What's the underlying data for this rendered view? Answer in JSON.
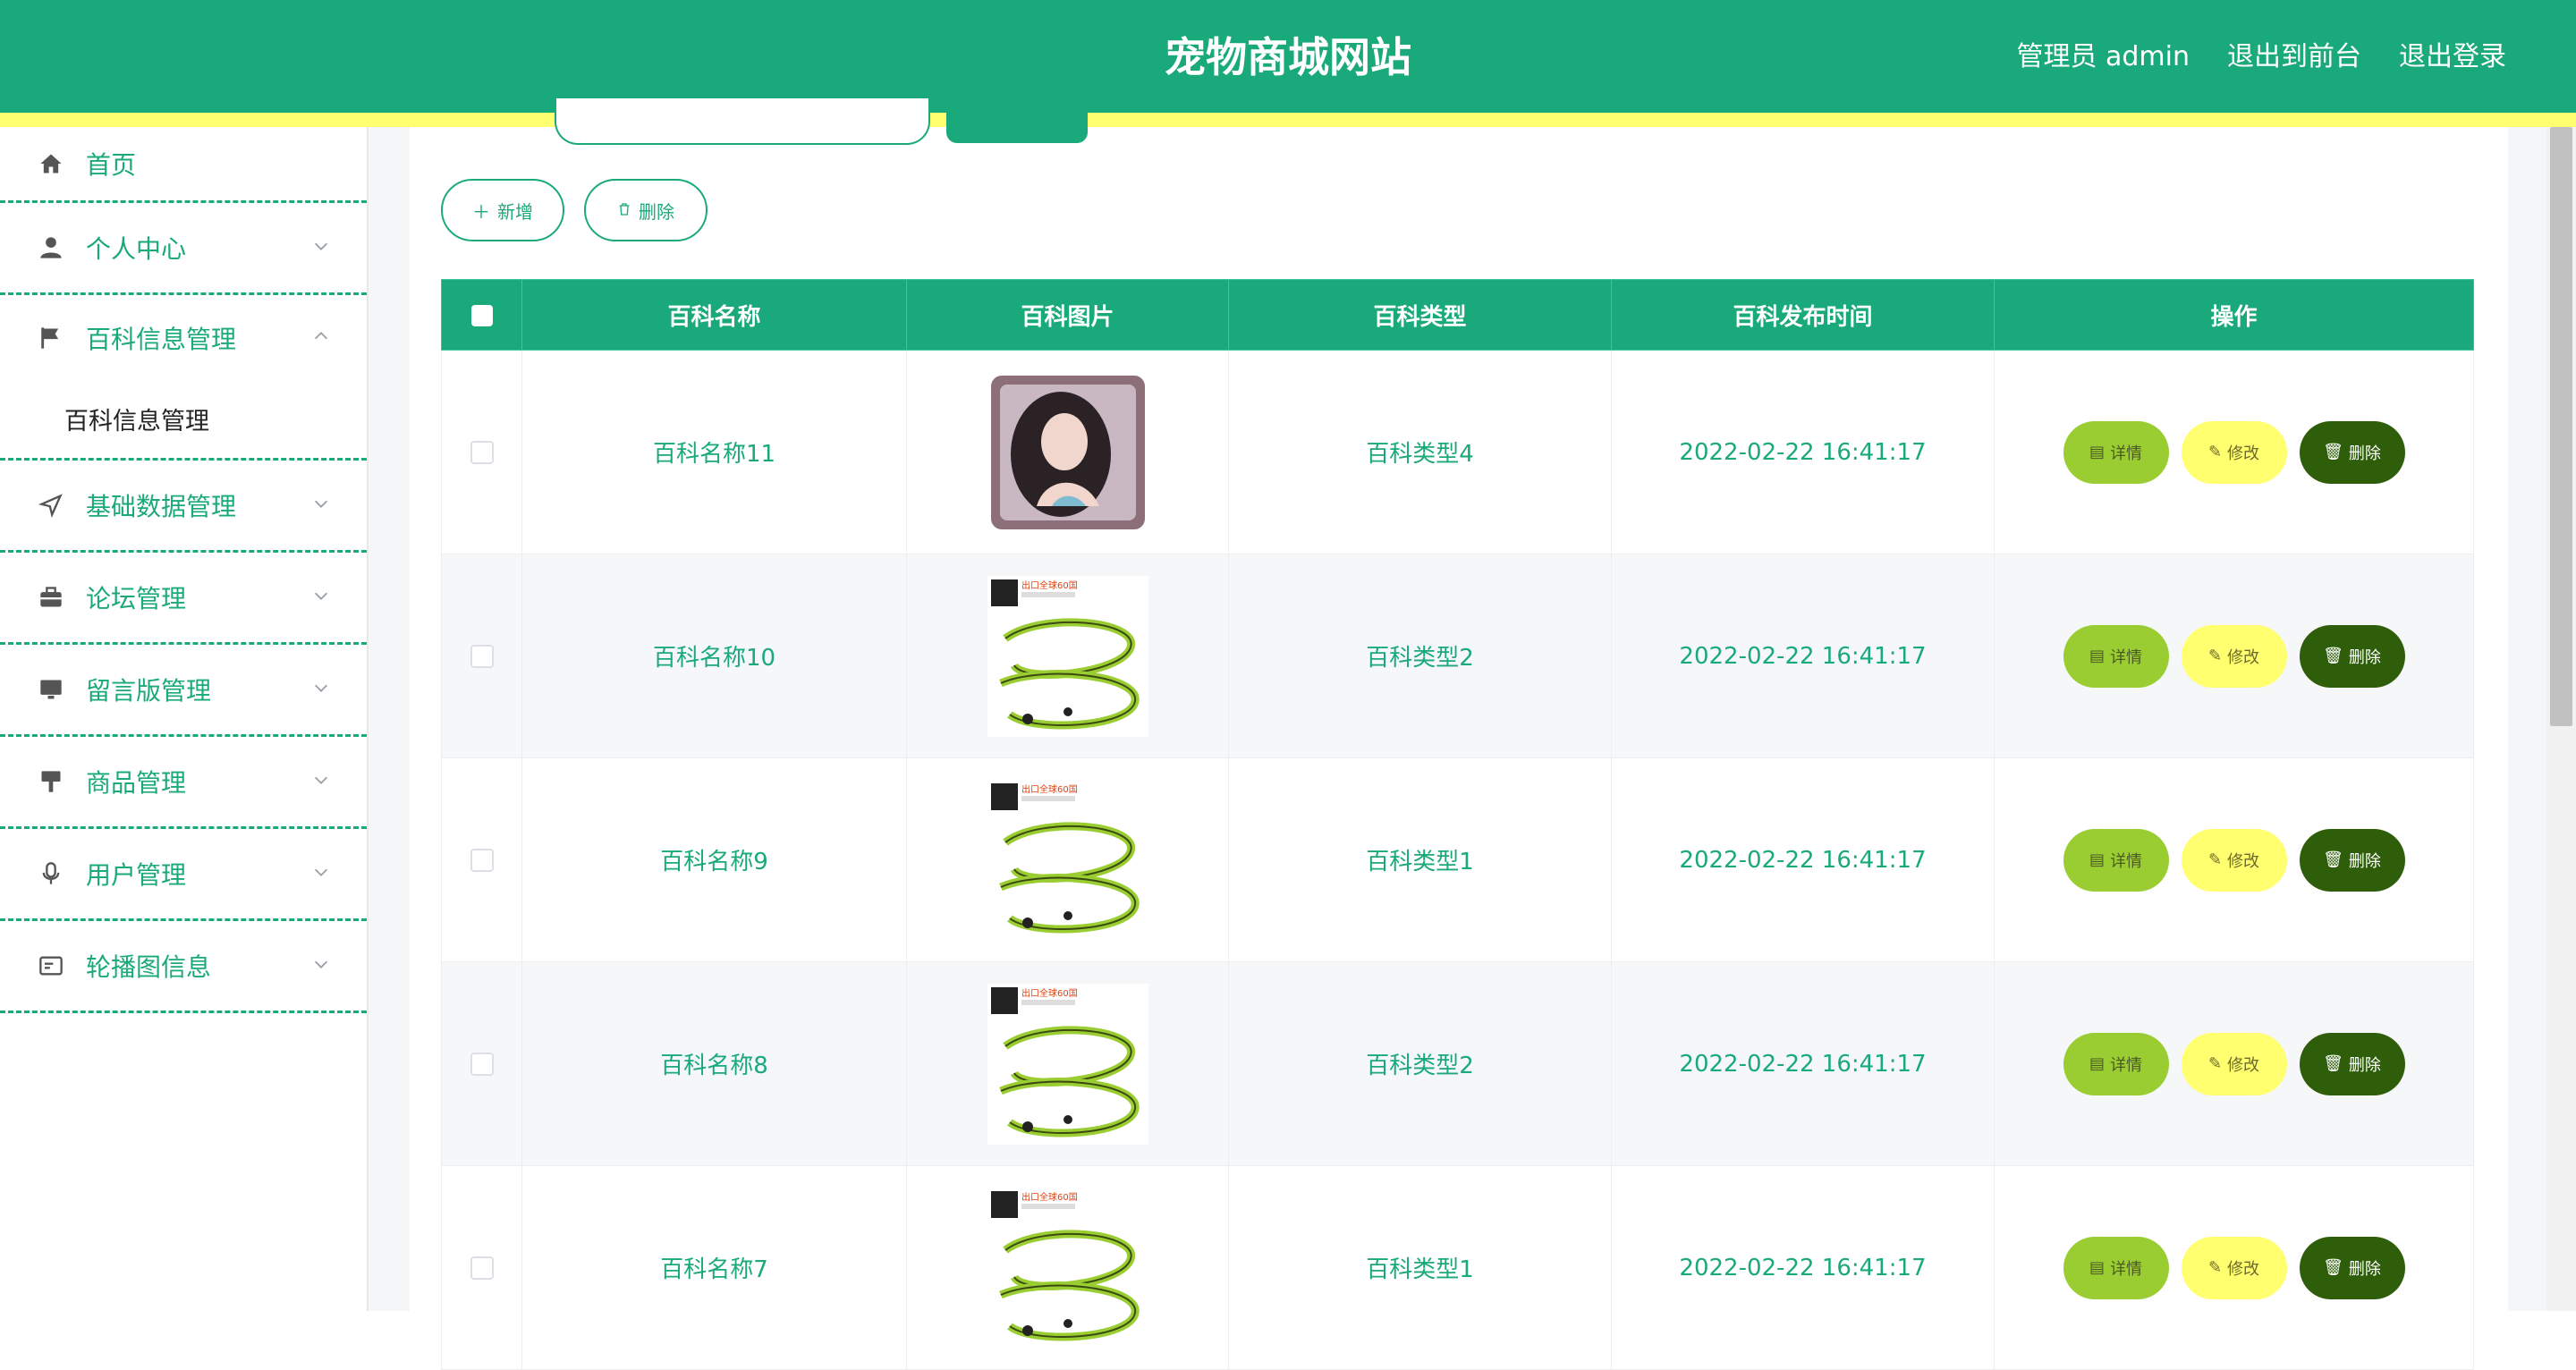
{
  "header": {
    "title": "宠物商城网站",
    "admin_label": "管理员 admin",
    "to_front_label": "退出到前台",
    "logout_label": "退出登录"
  },
  "sidebar": {
    "items": [
      {
        "label": "首页",
        "icon": "home-icon"
      },
      {
        "label": "个人中心",
        "icon": "user-icon"
      },
      {
        "label": "百科信息管理",
        "icon": "flag-icon",
        "sub": "百科信息管理"
      },
      {
        "label": "基础数据管理",
        "icon": "send-icon"
      },
      {
        "label": "论坛管理",
        "icon": "briefcase-icon"
      },
      {
        "label": "留言版管理",
        "icon": "monitor-icon"
      },
      {
        "label": "商品管理",
        "icon": "brush-icon"
      },
      {
        "label": "用户管理",
        "icon": "microphone-icon"
      },
      {
        "label": "轮播图信息",
        "icon": "card-icon"
      }
    ]
  },
  "toolbar": {
    "add_label": "新增",
    "delete_label": "删除"
  },
  "table": {
    "headers": [
      "百科名称",
      "百科图片",
      "百科类型",
      "百科发布时间",
      "操作"
    ],
    "rows": [
      {
        "name": "百科名称11",
        "type": "百科类型4",
        "time": "2022-02-22 16:41:17",
        "image": "portrait-photo"
      },
      {
        "name": "百科名称10",
        "type": "百科类型2",
        "time": "2022-02-22 16:41:17",
        "image": "leash-photo",
        "image_caption": "出口全球60国"
      },
      {
        "name": "百科名称9",
        "type": "百科类型1",
        "time": "2022-02-22 16:41:17",
        "image": "leash-photo",
        "image_caption": "出口全球60国"
      },
      {
        "name": "百科名称8",
        "type": "百科类型2",
        "time": "2022-02-22 16:41:17",
        "image": "leash-photo",
        "image_caption": "出口全球60国"
      },
      {
        "name": "百科名称7",
        "type": "百科类型1",
        "time": "2022-02-22 16:41:17",
        "image": "leash-photo",
        "image_caption": "出口全球60国"
      }
    ],
    "actions": {
      "detail": "详情",
      "edit": "修改",
      "delete": "删除"
    }
  },
  "colors": {
    "primary": "#1aa97a",
    "accent_yellow": "#ffff70",
    "detail_btn": "#9acd32",
    "delete_btn": "#2e5e0a"
  }
}
